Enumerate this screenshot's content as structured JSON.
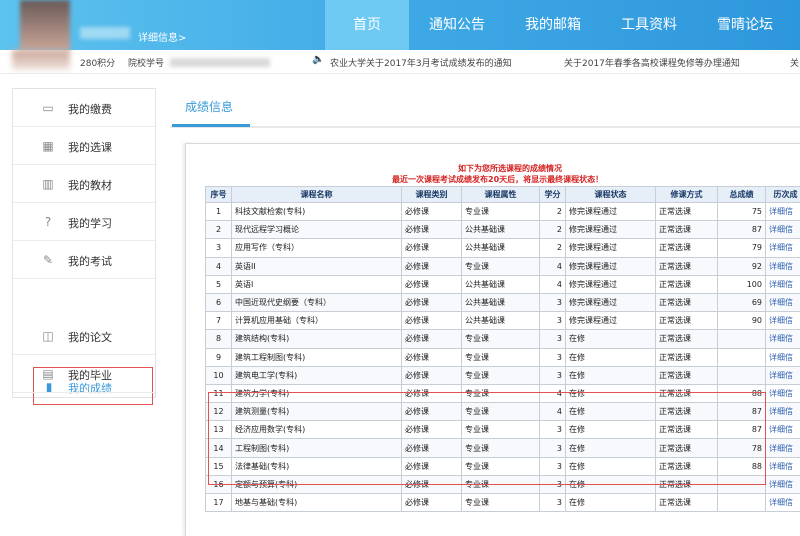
{
  "header": {
    "detail_link": "详细信息>",
    "nav": [
      {
        "label": "首页",
        "active": true
      },
      {
        "label": "通知公告",
        "active": false
      },
      {
        "label": "我的邮箱",
        "active": false
      },
      {
        "label": "工具资料",
        "active": false
      },
      {
        "label": "雪晴论坛",
        "active": false
      }
    ]
  },
  "infobar": {
    "points": "280积分",
    "school": "院校学号",
    "notices": [
      "农业大学关于2017年3月考试成绩发布的通知",
      "关于2017年春季各高校课程免修等办理通知",
      "关"
    ]
  },
  "sidebar": {
    "items": [
      {
        "label": "我的缴费",
        "icon": "wallet-icon",
        "glyph": "▭"
      },
      {
        "label": "我的选课",
        "icon": "grid-icon",
        "glyph": "▦"
      },
      {
        "label": "我的教材",
        "icon": "book-icon",
        "glyph": "▥"
      },
      {
        "label": "我的学习",
        "icon": "question-icon",
        "glyph": "?"
      },
      {
        "label": "我的考试",
        "icon": "exam-icon",
        "glyph": "✎"
      },
      {
        "label": "我的成绩",
        "icon": "chart-icon",
        "glyph": "▮"
      },
      {
        "label": "我的论文",
        "icon": "paper-icon",
        "glyph": "◫"
      },
      {
        "label": "我的毕业",
        "icon": "certificate-icon",
        "glyph": "▤"
      }
    ],
    "active_index": 5,
    "active_color": "#3a9ad9"
  },
  "main": {
    "title": "成绩信息",
    "heading1": "如下为您所选课程的成绩情况",
    "heading2": "最近一次课程考试成绩发布20天后，将显示最终课程状态！",
    "columns": [
      "序号",
      "课程名称",
      "课程类别",
      "课程属性",
      "学分",
      "课程状态",
      "修课方式",
      "总成绩",
      "历次成"
    ],
    "rows": [
      [
        "1",
        "科技文献检索(专科)",
        "必修课",
        "专业课",
        "2",
        "修完课程通过",
        "正常选课",
        "75",
        "详细信"
      ],
      [
        "2",
        "现代远程学习概论",
        "必修课",
        "公共基础课",
        "2",
        "修完课程通过",
        "正常选课",
        "87",
        "详细信"
      ],
      [
        "3",
        "应用写作（专科）",
        "必修课",
        "公共基础课",
        "2",
        "修完课程通过",
        "正常选课",
        "79",
        "详细信"
      ],
      [
        "4",
        "英语II",
        "必修课",
        "专业课",
        "4",
        "修完课程通过",
        "正常选课",
        "92",
        "详细信"
      ],
      [
        "5",
        "英语I",
        "必修课",
        "公共基础课",
        "4",
        "修完课程通过",
        "正常选课",
        "100",
        "详细信"
      ],
      [
        "6",
        "中国近现代史纲要（专科）",
        "必修课",
        "公共基础课",
        "3",
        "修完课程通过",
        "正常选课",
        "69",
        "详细信"
      ],
      [
        "7",
        "计算机应用基础（专科）",
        "必修课",
        "公共基础课",
        "3",
        "修完课程通过",
        "正常选课",
        "90",
        "详细信"
      ],
      [
        "8",
        "建筑结构(专科)",
        "必修课",
        "专业课",
        "3",
        "在修",
        "正常选课",
        "",
        "详细信"
      ],
      [
        "9",
        "建筑工程制图(专科)",
        "必修课",
        "专业课",
        "3",
        "在修",
        "正常选课",
        "",
        "详细信"
      ],
      [
        "10",
        "建筑电工学(专科)",
        "必修课",
        "专业课",
        "3",
        "在修",
        "正常选课",
        "",
        "详细信"
      ],
      [
        "11",
        "建筑力学(专科)",
        "必修课",
        "专业课",
        "4",
        "在修",
        "正常选课",
        "88",
        "详细信"
      ],
      [
        "12",
        "建筑测量(专科)",
        "必修课",
        "专业课",
        "4",
        "在修",
        "正常选课",
        "87",
        "详细信"
      ],
      [
        "13",
        "经济应用数学(专科)",
        "必修课",
        "专业课",
        "3",
        "在修",
        "正常选课",
        "87",
        "详细信"
      ],
      [
        "14",
        "工程制图(专科)",
        "必修课",
        "专业课",
        "3",
        "在修",
        "正常选课",
        "78",
        "详细信"
      ],
      [
        "15",
        "法律基础(专科)",
        "必修课",
        "专业课",
        "3",
        "在修",
        "正常选课",
        "88",
        "详细信"
      ],
      [
        "16",
        "定额与预算(专科)",
        "必修课",
        "专业课",
        "3",
        "在修",
        "正常选课",
        "",
        "详细信"
      ],
      [
        "17",
        "地基与基础(专科)",
        "必修课",
        "专业课",
        "3",
        "在修",
        "正常选课",
        "",
        "详细信"
      ]
    ]
  }
}
